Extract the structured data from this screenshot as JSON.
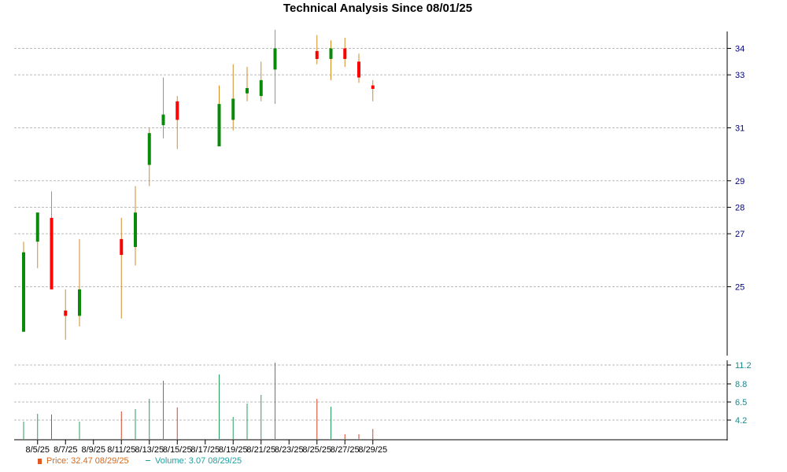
{
  "colors": {
    "up": "#0a8a0a",
    "down": "#ff0000",
    "wick": "#d28b26",
    "vol_up": "#2a9d5c",
    "vol_down": "#d2452b",
    "axis_text_price": "#000080",
    "axis_text_volume": "#1a8a8a",
    "grid": "#bbbbbb",
    "legend_price": "#d2691e",
    "legend_volume": "#20a0a0"
  },
  "chart_data": {
    "type": "candlestick",
    "title": "Technical Analysis Since 08/01/25",
    "price_axis": {
      "ticks": [
        25,
        27,
        28,
        29,
        31,
        33,
        34
      ],
      "range": [
        22.4,
        34.4
      ]
    },
    "volume_axis": {
      "ticks": [
        4.2,
        6.5,
        8.8,
        11.2
      ],
      "range": [
        1.8,
        11.6
      ]
    },
    "x_ticks": [
      "8/5/25",
      "8/7/25",
      "8/9/25",
      "8/11/25",
      "8/13/25",
      "8/15/25",
      "8/17/25",
      "8/19/25",
      "8/21/25",
      "8/23/25",
      "8/25/25",
      "8/27/25",
      "8/29/25"
    ],
    "date_range": [
      "2025-08-04",
      "2025-08-29"
    ],
    "candles": [
      {
        "date": "2025-08-04",
        "open": 23.3,
        "high": 26.7,
        "low": 23.3,
        "close": 26.3,
        "volume": 4.0
      },
      {
        "date": "2025-08-05",
        "open": 26.7,
        "high": 27.8,
        "low": 25.7,
        "close": 27.8,
        "volume": 5.0
      },
      {
        "date": "2025-08-06",
        "open": 27.6,
        "high": 28.6,
        "low": 24.9,
        "close": 24.9,
        "volume": 4.9
      },
      {
        "date": "2025-08-07",
        "open": 24.1,
        "high": 24.9,
        "low": 23.0,
        "close": 23.9,
        "volume": 1.8
      },
      {
        "date": "2025-08-08",
        "open": 23.9,
        "high": 26.8,
        "low": 23.5,
        "close": 24.9,
        "volume": 4.0
      },
      {
        "date": "2025-08-11",
        "open": 26.8,
        "high": 27.6,
        "low": 23.8,
        "close": 26.2,
        "volume": 5.3
      },
      {
        "date": "2025-08-12",
        "open": 26.5,
        "high": 28.8,
        "low": 25.8,
        "close": 27.8,
        "volume": 5.6
      },
      {
        "date": "2025-08-13",
        "open": 29.6,
        "high": 31.0,
        "low": 28.8,
        "close": 30.8,
        "volume": 6.9
      },
      {
        "date": "2025-08-14",
        "open": 31.1,
        "high": 32.9,
        "low": 30.6,
        "close": 31.5,
        "volume": 9.2
      },
      {
        "date": "2025-08-15",
        "open": 32.0,
        "high": 32.2,
        "low": 30.2,
        "close": 31.3,
        "volume": 5.8
      },
      {
        "date": "2025-08-18",
        "open": 30.3,
        "high": 32.6,
        "low": 30.3,
        "close": 31.9,
        "volume": 10.0
      },
      {
        "date": "2025-08-19",
        "open": 31.3,
        "high": 33.4,
        "low": 30.9,
        "close": 32.1,
        "volume": 4.6
      },
      {
        "date": "2025-08-20",
        "open": 32.3,
        "high": 33.3,
        "low": 32.0,
        "close": 32.5,
        "volume": 6.3
      },
      {
        "date": "2025-08-21",
        "open": 32.2,
        "high": 33.5,
        "low": 32.0,
        "close": 32.8,
        "volume": 7.4
      },
      {
        "date": "2025-08-22",
        "open": 33.2,
        "high": 34.7,
        "low": 31.9,
        "close": 34.0,
        "volume": 11.5
      },
      {
        "date": "2025-08-25",
        "open": 33.9,
        "high": 34.5,
        "low": 33.4,
        "close": 33.6,
        "volume": 6.9
      },
      {
        "date": "2025-08-26",
        "open": 33.6,
        "high": 34.3,
        "low": 32.8,
        "close": 34.0,
        "volume": 5.9
      },
      {
        "date": "2025-08-27",
        "open": 34.0,
        "high": 34.4,
        "low": 33.3,
        "close": 33.6,
        "volume": 2.4
      },
      {
        "date": "2025-08-28",
        "open": 33.5,
        "high": 33.8,
        "low": 32.7,
        "close": 32.9,
        "volume": 2.4
      },
      {
        "date": "2025-08-29",
        "open": 32.6,
        "high": 32.8,
        "low": 32.0,
        "close": 32.47,
        "volume": 3.07
      }
    ]
  },
  "legend": {
    "price_text": "Price: 32.47  08/29/25",
    "volume_text": "Volume: 3.07  08/29/25"
  }
}
